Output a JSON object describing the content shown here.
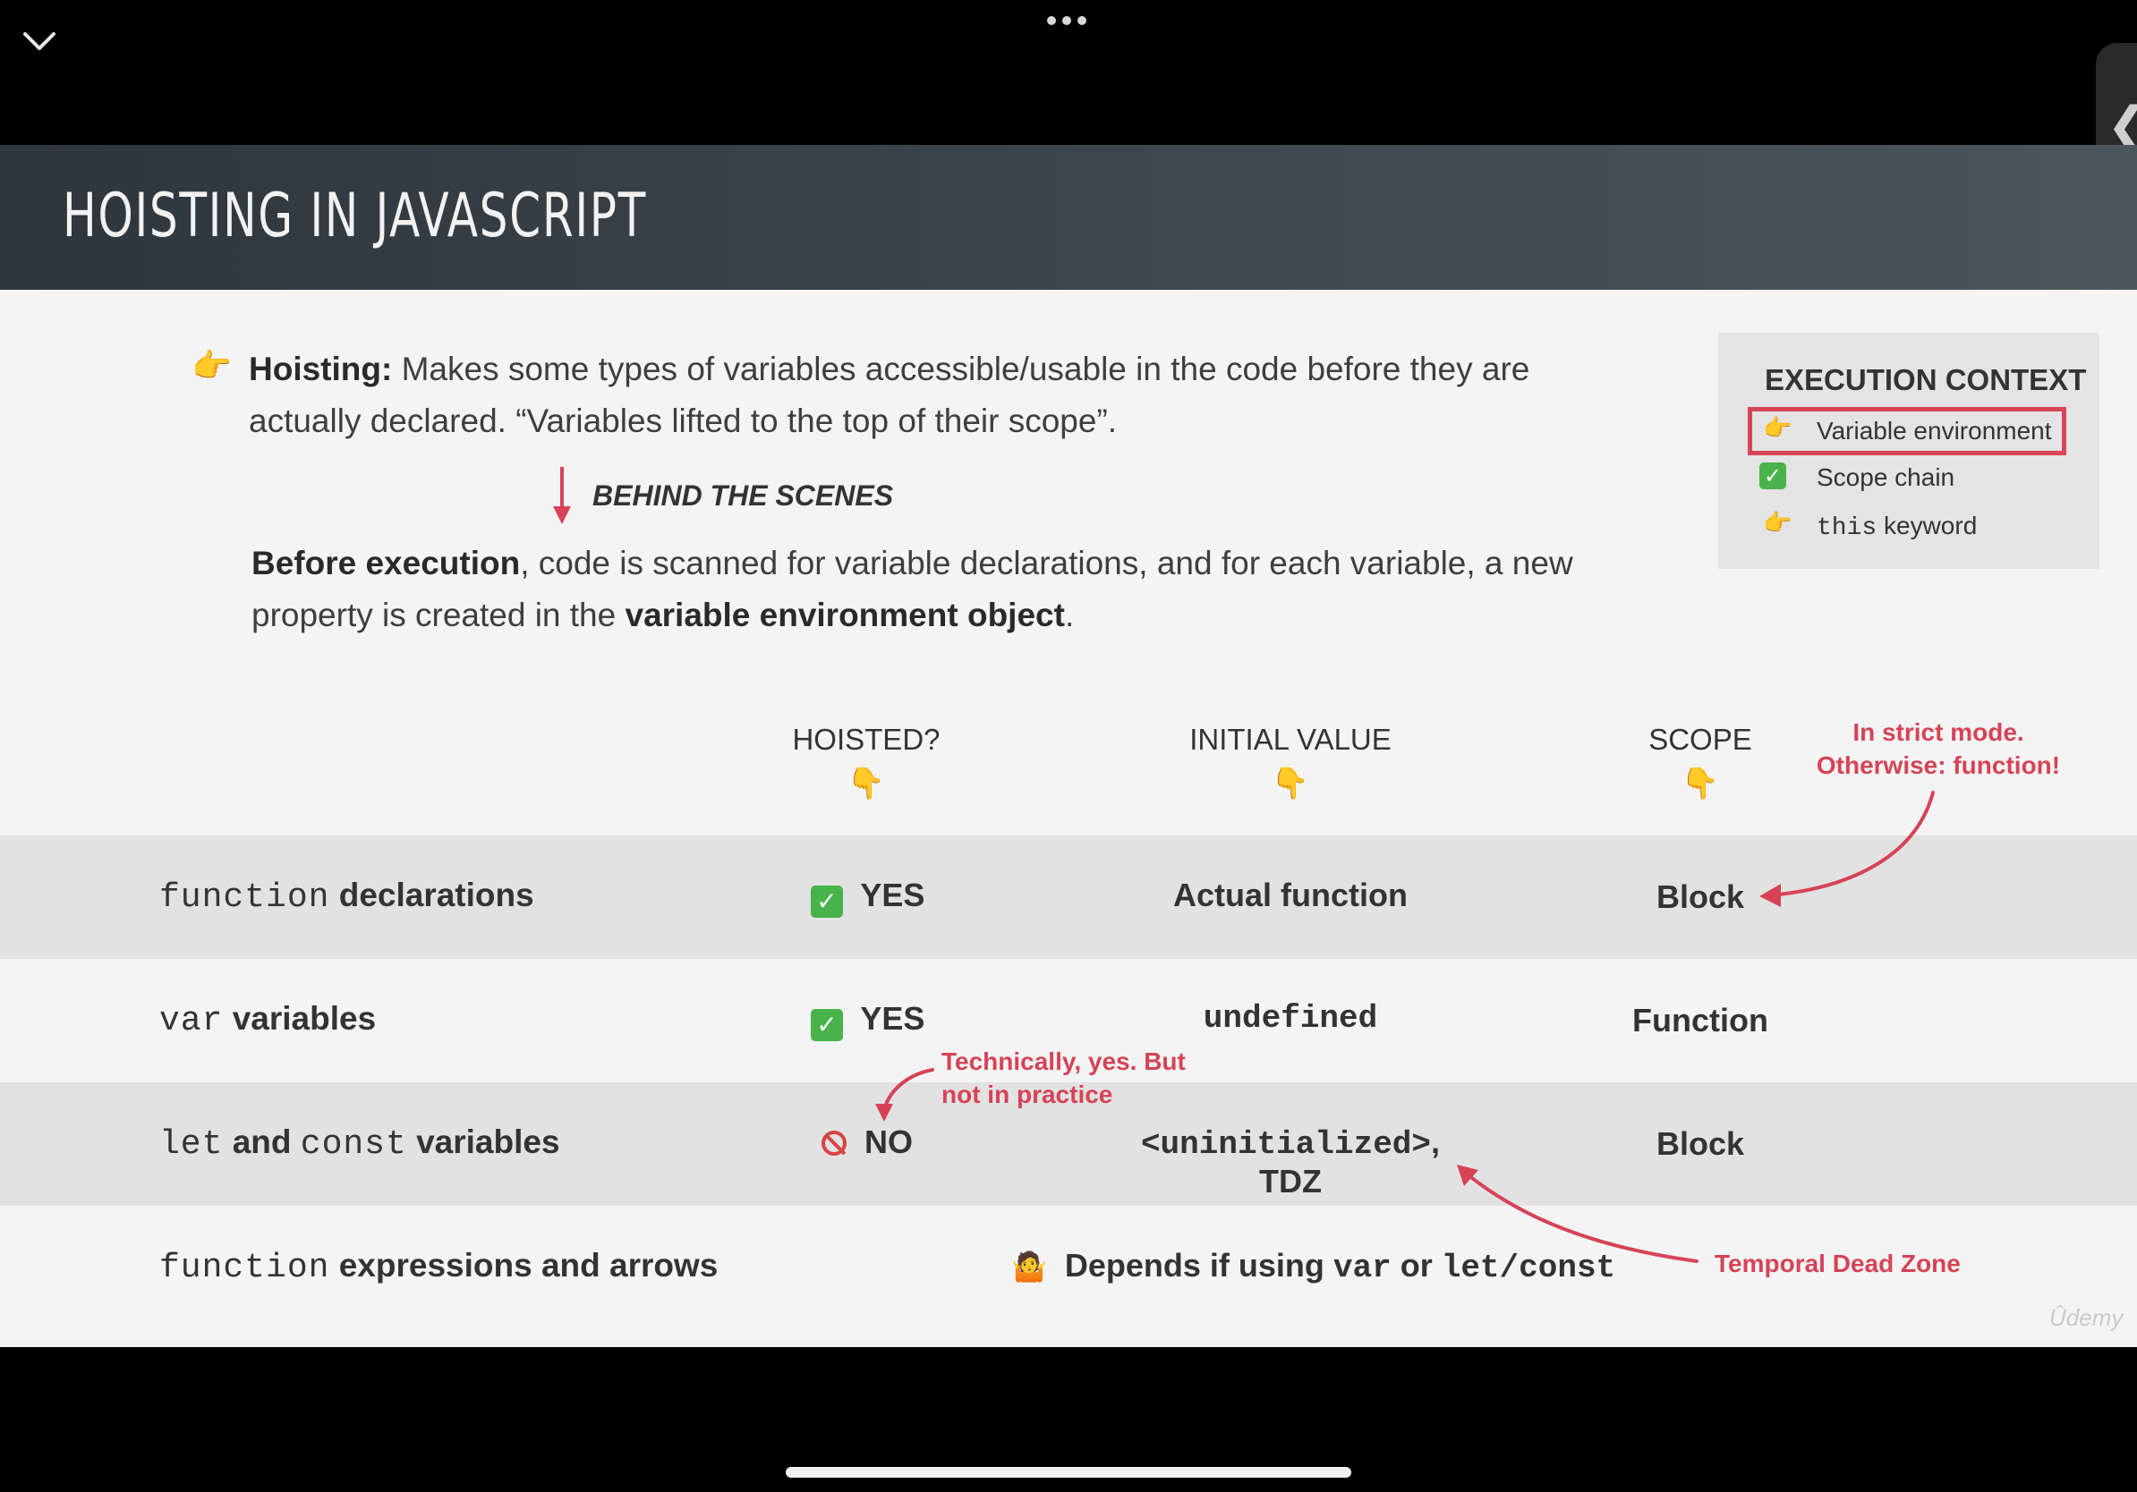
{
  "title": "HOISTING IN JAVASCRIPT",
  "intro": {
    "term": "Hoisting:",
    "text_line1": " Makes some types of variables accessible/usable in the code before they are",
    "text_line2": "actually declared. “Variables lifted to the top of their scope”."
  },
  "behind_label": "BEHIND THE SCENES",
  "explanation": {
    "bold_start": "Before execution",
    "middle_line1": ", code is scanned for variable declarations, and for each variable, a new",
    "middle_line2": "property is created in the ",
    "bold_end": "variable environment object",
    "end": "."
  },
  "execution_context": {
    "title": "EXECUTION CONTEXT",
    "items": [
      {
        "label": "Variable environment",
        "icon": "pointing-hand-icon",
        "highlighted": true
      },
      {
        "label": "Scope chain",
        "icon": "checkmark-icon"
      },
      {
        "label_code": "this",
        "label_rest": " keyword",
        "icon": "pointing-hand-icon"
      }
    ],
    "highlight_color": "#d94558"
  },
  "columns": [
    "HOISTED?",
    "INITIAL VALUE",
    "SCOPE"
  ],
  "rows": [
    {
      "code": "function",
      "rest": " declarations",
      "hoisted": "YES",
      "initial": "Actual function",
      "scope": "Block"
    },
    {
      "code": "var",
      "rest": " variables",
      "hoisted": "YES",
      "initial": "undefined",
      "scope": "Function"
    },
    {
      "code1": "let",
      "mid": " and ",
      "code2": "const",
      "rest": " variables",
      "hoisted": "NO",
      "initial_code": "<uninitialized>",
      "initial_rest": ", TDZ",
      "scope": "Block"
    },
    {
      "code": "function",
      "rest": " expressions and arrows",
      "dep_text": "Depends if using ",
      "dep_code1": "var",
      "dep_or": " or ",
      "dep_code2": "let/const"
    }
  ],
  "notes": {
    "strict_line1": "In strict mode.",
    "strict_line2": "Otherwise: function!",
    "technically_line1": "Technically, yes. But",
    "technically_line2": "not in practice",
    "tdz": "Temporal Dead Zone"
  },
  "watermark": "Ûdemy",
  "accent_color": "#d64356"
}
